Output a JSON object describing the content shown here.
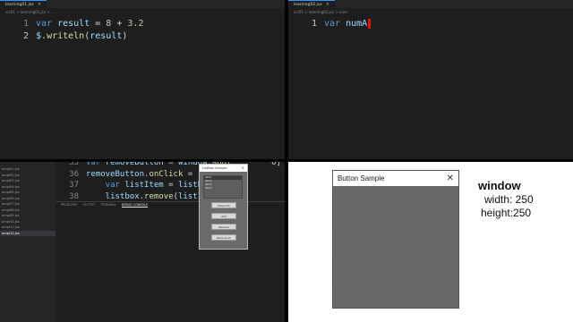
{
  "top_left": {
    "tab_title": "learning01.jsx",
    "breadcrumb": "src01 > learning01.jsx > ...",
    "lines": [
      {
        "num": "1",
        "tokens": [
          {
            "t": "var ",
            "c": "kw"
          },
          {
            "t": "result",
            "c": "id"
          },
          {
            "t": " = ",
            "c": "op"
          },
          {
            "t": "8",
            "c": "num"
          },
          {
            "t": " + ",
            "c": "op"
          },
          {
            "t": "3.2",
            "c": "num"
          }
        ]
      },
      {
        "num": "2",
        "tokens": [
          {
            "t": "$",
            "c": "id"
          },
          {
            "t": ".",
            "c": "op"
          },
          {
            "t": "writeln",
            "c": "fn"
          },
          {
            "t": "(",
            "c": "op"
          },
          {
            "t": "result",
            "c": "id"
          },
          {
            "t": ")",
            "c": "op"
          }
        ]
      }
    ]
  },
  "top_right": {
    "tab_title": "learning02.jsx",
    "breadcrumb": "src01 > learning02.jsx > num",
    "lines": [
      {
        "num": "1",
        "tokens": [
          {
            "t": "var ",
            "c": "kw"
          },
          {
            "t": "numA",
            "c": "id"
          }
        ]
      }
    ]
  },
  "bottom_left": {
    "files": [
      "ampl01.jsx",
      "ampl02.jsx",
      "ampl03.jsx",
      "ampl04.jsx",
      "ampl05.jsx",
      "ampl06.jsx",
      "ampl07.jsx",
      "ampl08.jsx",
      "ampl09.jsx",
      "ampl10.jsx",
      "ampl11.jsx",
      "ampl12.jsx"
    ],
    "selected_file_index": 11,
    "lines": [
      {
        "num": "35",
        "tokens": [
          {
            "t": "var ",
            "c": "kw"
          },
          {
            "t": "removeButton",
            "c": "id"
          },
          {
            "t": " = ",
            "c": "op"
          },
          {
            "t": "window",
            "c": "id"
          },
          {
            "t": ".",
            "c": "op"
          },
          {
            "t": "add",
            "c": "fn"
          },
          {
            "t": "(",
            "c": "op"
          }
        ]
      },
      {
        "num": "36",
        "tokens": [
          {
            "t": "removeButton",
            "c": "id"
          },
          {
            "t": ".",
            "c": "op"
          },
          {
            "t": "onClick",
            "c": "fn"
          },
          {
            "t": " = ",
            "c": "op"
          },
          {
            "t": "fun",
            "c": "kw"
          }
        ]
      },
      {
        "num": "37",
        "tokens": [
          {
            "t": "    var ",
            "c": "kw"
          },
          {
            "t": "listItem",
            "c": "id"
          },
          {
            "t": " = ",
            "c": "op"
          },
          {
            "t": "listbo",
            "c": "id"
          }
        ]
      },
      {
        "num": "38",
        "tokens": [
          {
            "t": "    listbox",
            "c": "id"
          },
          {
            "t": ".",
            "c": "op"
          },
          {
            "t": "remove",
            "c": "fn"
          },
          {
            "t": "(",
            "c": "op"
          },
          {
            "t": "listIte",
            "c": "id"
          }
        ]
      }
    ],
    "right_overflow": "0]",
    "panel_tabs": [
      "PROBLEMS",
      "OUTPUT",
      "TERMINAL",
      "DEBUG CONSOLE"
    ],
    "active_panel_tab": 3,
    "mini_window": {
      "title": "ListBox Sample",
      "list_items": [
        "item1",
        "item2",
        "item3",
        "item4"
      ],
      "buttons": [
        "Show Info",
        "Add",
        "Remove",
        "Remove All"
      ]
    }
  },
  "bottom_right": {
    "window_title": "Button Sample",
    "close_glyph": "✕",
    "note": {
      "title": "window",
      "width_line": "width: 250",
      "height_line": "height:250"
    }
  }
}
